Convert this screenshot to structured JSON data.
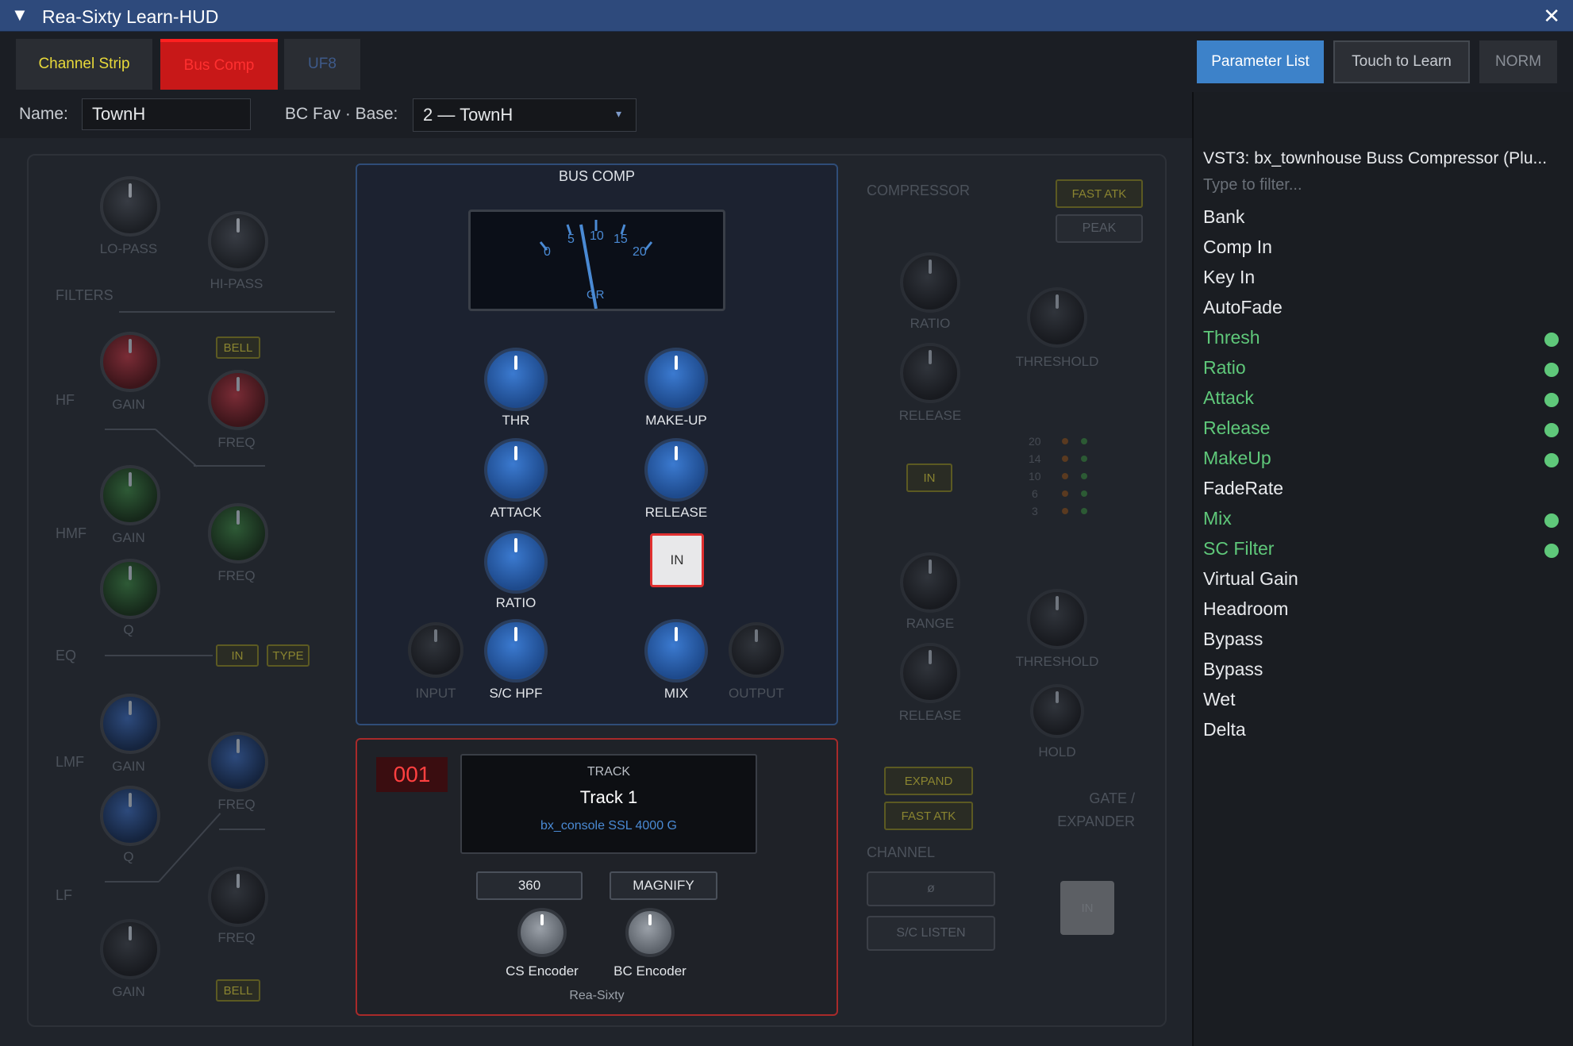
{
  "window": {
    "title": "Rea-Sixty Learn-HUD",
    "collapse_glyph": "▼",
    "close_glyph": "✕"
  },
  "tabs": [
    {
      "label": "Channel Strip",
      "color": "#e8d93a"
    },
    {
      "label": "Bus Comp",
      "color": "#ff2020"
    },
    {
      "label": "UF8",
      "color": "#3e5a8a"
    }
  ],
  "header_buttons": {
    "parameter_list": "Parameter List",
    "touch_to_learn": "Touch to Learn",
    "norm": "NORM"
  },
  "name_bar": {
    "name_label": "Name:",
    "name_value": "TownH",
    "fav_label": "BC Fav · Base:",
    "fav_value": "2 — TownH",
    "dropdown_arrow": "▾"
  },
  "strip": {
    "lo_pass": "LO-PASS",
    "hi_pass": "HI-PASS",
    "filters": "FILTERS",
    "hf": "HF",
    "hmf": "HMF",
    "eq": "EQ",
    "lmf": "LMF",
    "lf": "LF",
    "gain": "GAIN",
    "freq": "FREQ",
    "q": "Q",
    "bell": "BELL",
    "in": "IN",
    "type": "TYPE"
  },
  "bus_comp": {
    "title": "BUS COMP",
    "meter_scale": [
      "0",
      "5",
      "10",
      "15",
      "20"
    ],
    "meter_label": "GR",
    "thr": "THR",
    "makeup": "MAKE-UP",
    "attack": "ATTACK",
    "release": "RELEASE",
    "ratio": "RATIO",
    "in_button": "IN",
    "input": "INPUT",
    "sc_hpf": "S/C HPF",
    "mix": "MIX",
    "output": "OUTPUT"
  },
  "compressor": {
    "title": "COMPRESSOR",
    "fast_atk": "FAST ATK",
    "peak": "PEAK",
    "ratio": "RATIO",
    "threshold": "THRESHOLD",
    "release": "RELEASE",
    "in": "IN",
    "meter_scale": [
      "20",
      "14",
      "10",
      "6",
      "3"
    ],
    "range": "RANGE",
    "threshold2": "THRESHOLD",
    "release2": "RELEASE",
    "hold": "HOLD",
    "expand": "EXPAND",
    "fast_atk2": "FAST ATK",
    "gate_line1": "GATE /",
    "gate_line2": "EXPANDER",
    "channel": "CHANNEL",
    "phase": "ø",
    "sc_listen": "S/C LISTEN",
    "gate_in": "IN"
  },
  "track": {
    "number": "001",
    "label": "TRACK",
    "name": "Track 1",
    "plugin": "bx_console SSL 4000 G",
    "btn_360": "360",
    "btn_magnify": "MAGNIFY",
    "cs_encoder": "CS Encoder",
    "bc_encoder": "BC Encoder",
    "footer": "Rea-Sixty"
  },
  "parameter_list": {
    "plugin": "VST3: bx_townhouse Buss Compressor (Plu...",
    "filter_placeholder": "Type to filter...",
    "items": [
      {
        "label": "Bank",
        "learned": false
      },
      {
        "label": "Comp In",
        "learned": false
      },
      {
        "label": "Key In",
        "learned": false
      },
      {
        "label": "AutoFade",
        "learned": false
      },
      {
        "label": "Thresh",
        "learned": true
      },
      {
        "label": "Ratio",
        "learned": true
      },
      {
        "label": "Attack",
        "learned": true
      },
      {
        "label": "Release",
        "learned": true
      },
      {
        "label": "MakeUp",
        "learned": true
      },
      {
        "label": "FadeRate",
        "learned": false
      },
      {
        "label": "Mix",
        "learned": true
      },
      {
        "label": "SC Filter",
        "learned": true
      },
      {
        "label": "Virtual Gain",
        "learned": false
      },
      {
        "label": "Headroom",
        "learned": false
      },
      {
        "label": "Bypass",
        "learned": false
      },
      {
        "label": "Bypass",
        "learned": false
      },
      {
        "label": "Wet",
        "learned": false
      },
      {
        "label": "Delta",
        "learned": false
      }
    ]
  },
  "colors": {
    "accent": "#3d82c9",
    "learned": "#5fc87a",
    "bus_comp_tab": "#c81818"
  }
}
